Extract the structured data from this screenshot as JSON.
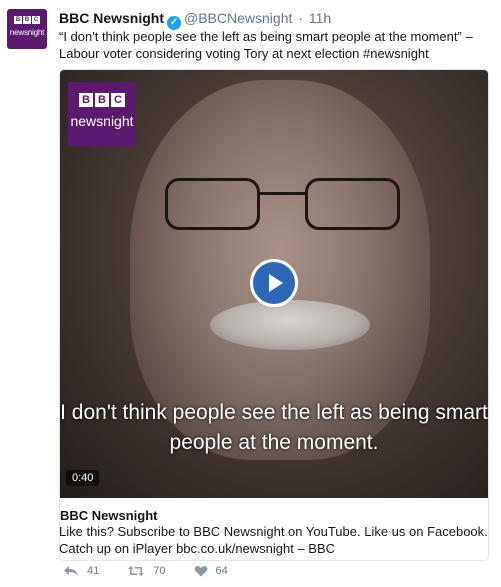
{
  "tweet": {
    "name": "BBC Newsnight",
    "handle": "@BBCNewsnight",
    "time": "11h",
    "text": "“I don't think people see the left as being smart people at the moment” – Labour voter considering voting Tory at next election #newsnight",
    "avatar_bbc": [
      "B",
      "B",
      "C"
    ],
    "avatar_word": "newsnight"
  },
  "video": {
    "badge_bbc": [
      "B",
      "B",
      "C"
    ],
    "badge_word": "newsnight",
    "caption": "I don't think people see the left as being smart people at the moment.",
    "duration": "0:40"
  },
  "card": {
    "title": "BBC Newsnight",
    "description": "Like this? Subscribe to BBC Newsnight on YouTube. Like us on Facebook. Catch up on iPlayer bbc.co.uk/newsnight – BBC"
  },
  "actions": {
    "reply_count": "41",
    "retweet_count": "70",
    "like_count": "64"
  },
  "colors": {
    "brand_purple": "#5b1a6e",
    "verified_blue": "#1da1f2",
    "play_blue": "#2c68b4",
    "meta_gray": "#657786"
  }
}
